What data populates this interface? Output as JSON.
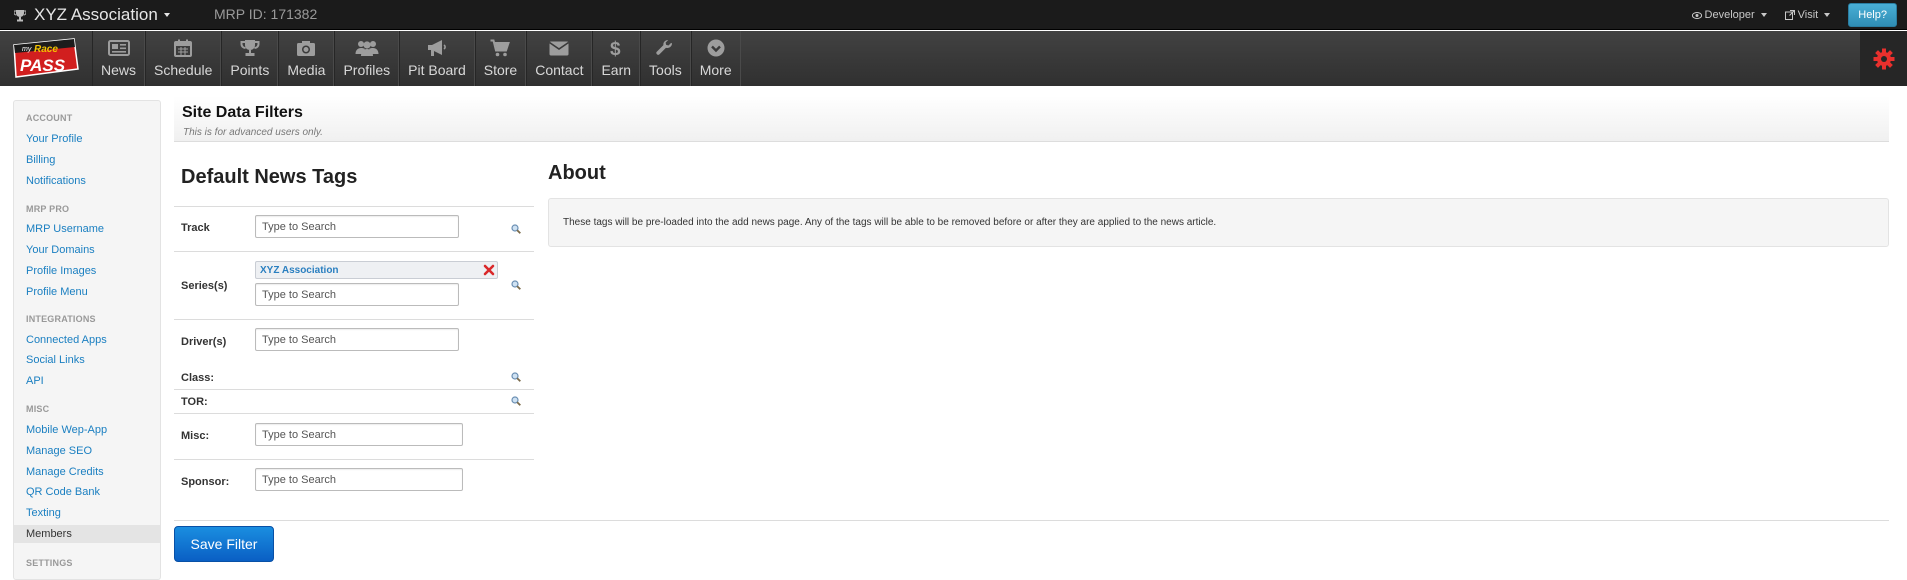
{
  "topbar": {
    "brand": "XYZ Association",
    "mrp_id": "MRP ID: 171382",
    "developer": "Developer",
    "visit": "Visit",
    "help": "Help?"
  },
  "logo": {
    "line1": "my",
    "line2": "Race",
    "line3": "PASS"
  },
  "nav": {
    "items": [
      {
        "label": "News",
        "icon": "newspaper-icon"
      },
      {
        "label": "Schedule",
        "icon": "calendar-icon"
      },
      {
        "label": "Points",
        "icon": "trophy-icon"
      },
      {
        "label": "Media",
        "icon": "camera-icon"
      },
      {
        "label": "Profiles",
        "icon": "users-icon"
      },
      {
        "label": "Pit Board",
        "icon": "megaphone-icon"
      },
      {
        "label": "Store",
        "icon": "cart-icon"
      },
      {
        "label": "Contact",
        "icon": "envelope-icon"
      },
      {
        "label": "Earn",
        "icon": "dollar-icon"
      },
      {
        "label": "Tools",
        "icon": "wrench-icon"
      },
      {
        "label": "More",
        "icon": "chevron-circle-icon"
      }
    ],
    "gear_icon": "gear-icon",
    "gear_color": "#e8302d"
  },
  "sidebar": {
    "account": {
      "heading": "ACCOUNT",
      "items": [
        "Your Profile",
        "Billing",
        "Notifications"
      ]
    },
    "mrp_pro": {
      "heading": "MRP PRO",
      "items": [
        "MRP Username",
        "Your Domains",
        "Profile Images",
        "Profile Menu"
      ]
    },
    "integrations": {
      "heading": "INTEGRATIONS",
      "items": [
        "Connected Apps",
        "Social Links",
        "API"
      ]
    },
    "misc": {
      "heading": "MISC",
      "items": [
        "Mobile Wep-App",
        "Manage SEO",
        "Manage Credits",
        "QR Code Bank",
        "Texting",
        "Members"
      ]
    },
    "settings": {
      "heading": "SETTINGS"
    }
  },
  "main": {
    "title": "Site Data Filters",
    "subtitle": "This is for advanced users only.",
    "tags_title": "Default News Tags",
    "about_title": "About",
    "about_text": "These tags will be pre-loaded into the add news page. Any of the tags will be able to be removed before or after they are applied to the news article.",
    "placeholder": "Type to Search",
    "rows": {
      "track": "Track",
      "series": "Series(s)",
      "series_tag": "XYZ Association",
      "drivers": "Driver(s)",
      "class": "Class:",
      "tor": "TOR:",
      "misc": "Misc:",
      "sponsor": "Sponsor:"
    },
    "save_label": "Save Filter"
  },
  "colors": {
    "link": "#1a7fc1",
    "primary_button": "#0a6fd4",
    "help_button": "#3a9ac0",
    "topbar": "#1b1b1b",
    "navbar": "#3a3a3a"
  }
}
